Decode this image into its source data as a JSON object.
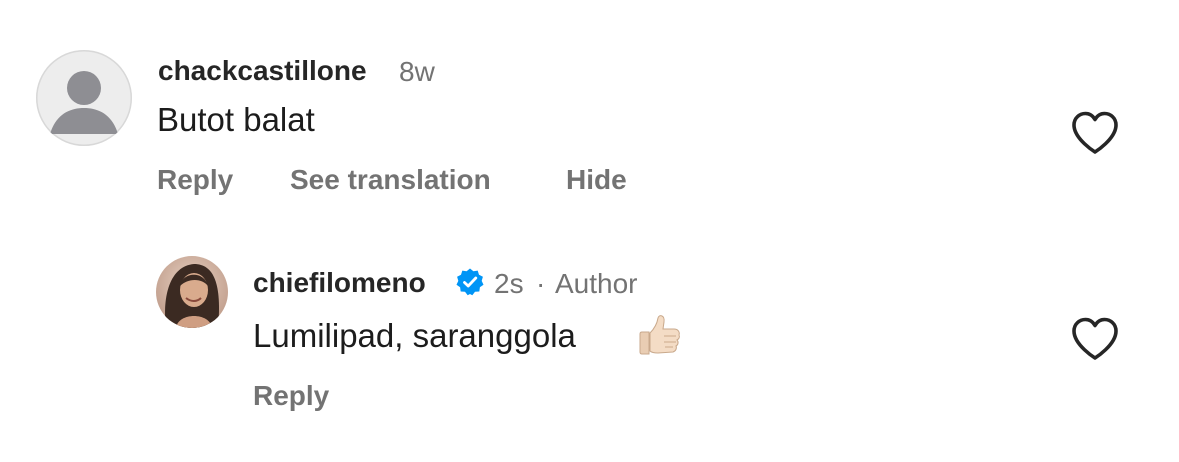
{
  "comments": [
    {
      "username": "chackcastillone",
      "time": "8w",
      "text": "Butot balat",
      "actions": {
        "reply": "Reply",
        "see_translation": "See translation",
        "hide": "Hide"
      },
      "avatar_icon": "default-user-icon",
      "like_icon": "heart-outline-icon"
    },
    {
      "username": "chiefilomeno",
      "verified_icon": "verified-badge-icon",
      "time": "2s",
      "separator": "·",
      "role": "Author",
      "text": "Lumilipad, saranggola",
      "emoji": "👍🏻",
      "actions": {
        "reply": "Reply"
      },
      "avatar_icon": "profile-photo",
      "like_icon": "heart-outline-icon"
    }
  ],
  "colors": {
    "primary_text": "#262626",
    "secondary_text": "#737373",
    "verified_blue": "#0095f6"
  }
}
